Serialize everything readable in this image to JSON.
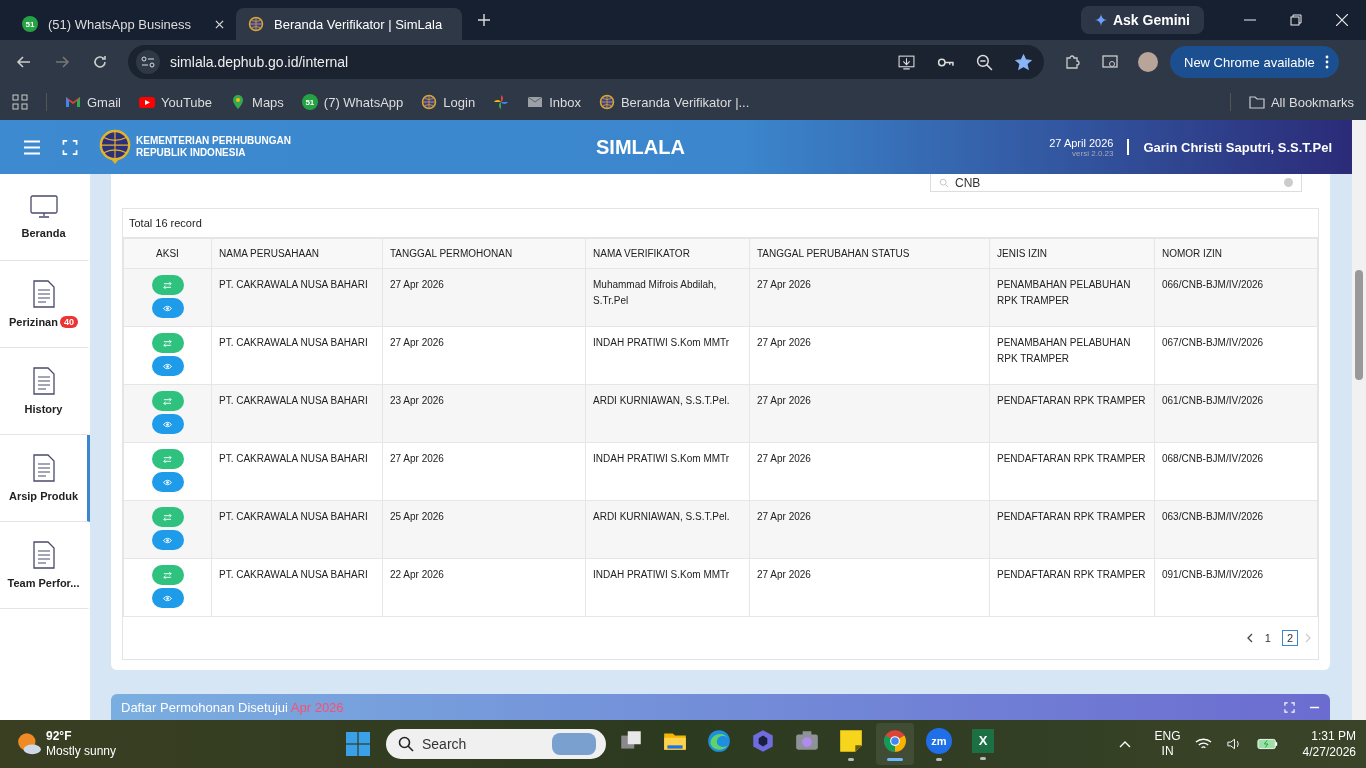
{
  "browser": {
    "tabs": [
      {
        "kind": "whatsapp",
        "icon_text": "51",
        "title": "(51) WhatsApp Business",
        "selected": false
      },
      {
        "kind": "simlala",
        "title": "Beranda Verifikator | SimLala",
        "selected": true
      }
    ],
    "ask_gemini": "Ask Gemini",
    "address": "simlala.dephub.go.id/internal",
    "bookmarked": true,
    "new_chrome": "New Chrome available",
    "bookmarks": [
      {
        "kind": "gmail",
        "label": "Gmail"
      },
      {
        "kind": "youtube",
        "label": "YouTube"
      },
      {
        "kind": "maps",
        "label": "Maps"
      },
      {
        "kind": "whatsapp",
        "icon_text": "51",
        "label": "(7) WhatsApp"
      },
      {
        "kind": "simlala",
        "label": "Login"
      },
      {
        "kind": "photos"
      },
      {
        "kind": "mail",
        "label": "Inbox"
      },
      {
        "kind": "simlala",
        "label": "Beranda Verifikator |..."
      }
    ],
    "all_bookmarks": "All Bookmarks"
  },
  "header": {
    "org_line1": "KEMENTERIAN PERHUBUNGAN",
    "org_line2": "REPUBLIK INDONESIA",
    "title": "SIMLALA",
    "date": "27 April 2026",
    "version": "versi 2.0.23",
    "user": "Garin Christi Saputri, S.S.T.Pel"
  },
  "sidebar": {
    "items": [
      {
        "kind": "monitor",
        "label": "Beranda",
        "selected": false
      },
      {
        "kind": "document",
        "label": "Perizinan",
        "badge": "40",
        "selected": false
      },
      {
        "kind": "document",
        "label": "History",
        "selected": false
      },
      {
        "kind": "document",
        "label": "Arsip Produk",
        "selected": true
      },
      {
        "kind": "document",
        "label": "Team Perfor...",
        "selected": false
      }
    ]
  },
  "search": {
    "value": "CNB"
  },
  "table": {
    "total": "Total 16 record",
    "columns": [
      "AKSI",
      "NAMA PERUSAHAAN",
      "TANGGAL PERMOHONAN",
      "NAMA VERIFIKATOR",
      "TANGGAL PERUBAHAN STATUS",
      "JENIS IZIN",
      "NOMOR IZIN"
    ],
    "rows": [
      [
        "",
        "PT. CAKRAWALA NUSA BAHARI",
        "27 Apr 2026",
        "Muhammad Mifrois Abdilah, S.Tr.Pel",
        "27 Apr 2026",
        "PENAMBAHAN PELABUHAN RPK TRAMPER",
        "066/CNB-BJM/IV/2026"
      ],
      [
        "",
        "PT. CAKRAWALA NUSA BAHARI",
        "27 Apr 2026",
        "INDAH PRATIWI S.Kom MMTr",
        "27 Apr 2026",
        "PENAMBAHAN PELABUHAN RPK TRAMPER",
        "067/CNB-BJM/IV/2026"
      ],
      [
        "",
        "PT. CAKRAWALA NUSA BAHARI",
        "23 Apr 2026",
        "ARDI KURNIAWAN, S.S.T.Pel.",
        "27 Apr 2026",
        "PENDAFTARAN RPK TRAMPER",
        "061/CNB-BJM/IV/2026"
      ],
      [
        "",
        "PT. CAKRAWALA NUSA BAHARI",
        "27 Apr 2026",
        "INDAH PRATIWI S.Kom MMTr",
        "27 Apr 2026",
        "PENDAFTARAN RPK TRAMPER",
        "068/CNB-BJM/IV/2026"
      ],
      [
        "",
        "PT. CAKRAWALA NUSA BAHARI",
        "25 Apr 2026",
        "ARDI KURNIAWAN, S.S.T.Pel.",
        "27 Apr 2026",
        "PENDAFTARAN RPK TRAMPER",
        "063/CNB-BJM/IV/2026"
      ],
      [
        "",
        "PT. CAKRAWALA NUSA BAHARI",
        "22 Apr 2026",
        "INDAH PRATIWI S.Kom MMTr",
        "27 Apr 2026",
        "PENDAFTARAN RPK TRAMPER",
        "091/CNB-BJM/IV/2026"
      ]
    ],
    "pages": [
      {
        "label": "1",
        "selected": false
      },
      {
        "label": "2",
        "selected": true
      }
    ]
  },
  "next_panel": {
    "title": "Daftar Permohonan Disetujui",
    "period": "Apr 2026"
  },
  "taskbar": {
    "temperature": "92°F",
    "weather": "Mostly sunny",
    "search_placeholder": "Search",
    "apps": [
      {
        "kind": "taskview",
        "running": false,
        "selected": false
      },
      {
        "kind": "explorer",
        "running": false,
        "selected": false
      },
      {
        "kind": "edge",
        "running": false,
        "selected": false
      },
      {
        "kind": "copilot",
        "running": false,
        "selected": false
      },
      {
        "kind": "camera",
        "running": false,
        "selected": false
      },
      {
        "kind": "notes",
        "running": true,
        "selected": false
      },
      {
        "kind": "chrome",
        "running": true,
        "selected": true
      },
      {
        "kind": "zoom",
        "icon_text": "zm",
        "running": true,
        "selected": false
      },
      {
        "kind": "excel",
        "icon_text": "X",
        "running": true,
        "selected": false
      }
    ],
    "language": "ENG",
    "region": "IN",
    "time": "1:31 PM",
    "date": "4/27/2026"
  }
}
